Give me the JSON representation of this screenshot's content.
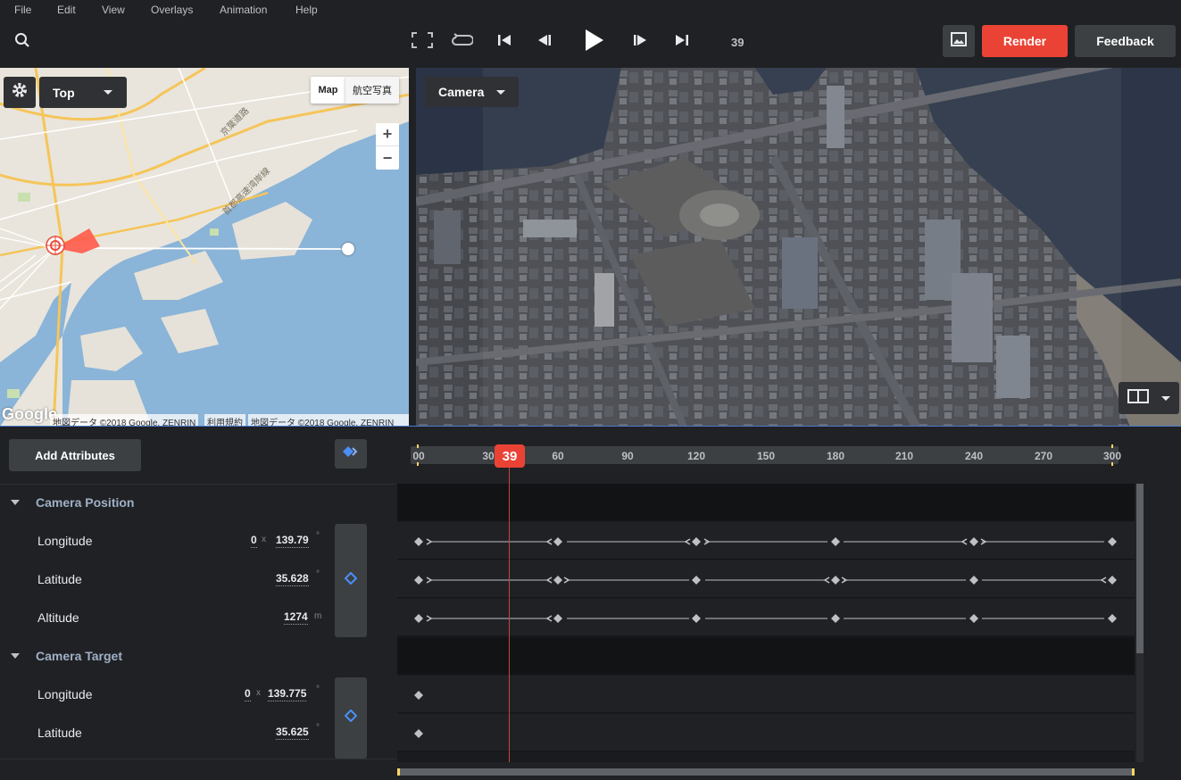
{
  "menu": [
    "File",
    "Edit",
    "View",
    "Overlays",
    "Animation",
    "Help"
  ],
  "toolbar": {
    "frame": "39",
    "render_label": "Render",
    "feedback_label": "Feedback"
  },
  "map": {
    "view_label": "Top",
    "maptype_map": "Map",
    "maptype_satellite": "航空写真",
    "zoom_in": "+",
    "zoom_out": "−",
    "google_logo": "Google",
    "attribution_left": "地図データ ©2018 Google, ZENRIN",
    "terms": "利用規約",
    "attribution_right": "地図データ ©2018 Google, ZENRIN",
    "road_label_1": "京葉道路",
    "road_label_2": "首都高速湾岸線"
  },
  "viewport": {
    "camera_label": "Camera"
  },
  "timeline": {
    "add_attributes_label": "Add Attributes",
    "playhead": "39",
    "ticks": [
      "00",
      "30",
      "60",
      "90",
      "120",
      "150",
      "180",
      "210",
      "240",
      "270",
      "300"
    ]
  },
  "groups": [
    {
      "title": "Camera Position",
      "attributes": [
        {
          "label": "Longitude",
          "prefix": "0",
          "prefix_mark": "x",
          "value": "139.79",
          "unit": "°"
        },
        {
          "label": "Latitude",
          "value": "35.628",
          "unit": "°"
        },
        {
          "label": "Altitude",
          "value": "1274",
          "unit": "m"
        }
      ]
    },
    {
      "title": "Camera Target",
      "attributes": [
        {
          "label": "Longitude",
          "prefix": "0",
          "prefix_mark": "x",
          "value": "139.775",
          "unit": "°"
        },
        {
          "label": "Latitude",
          "value": "35.625",
          "unit": "°"
        }
      ]
    }
  ],
  "colors": {
    "accent": "#ea4335",
    "panel": "#202124",
    "button": "#3c4043",
    "keyframe_blue": "#4a8ff7",
    "water": "#8ab4d8"
  }
}
